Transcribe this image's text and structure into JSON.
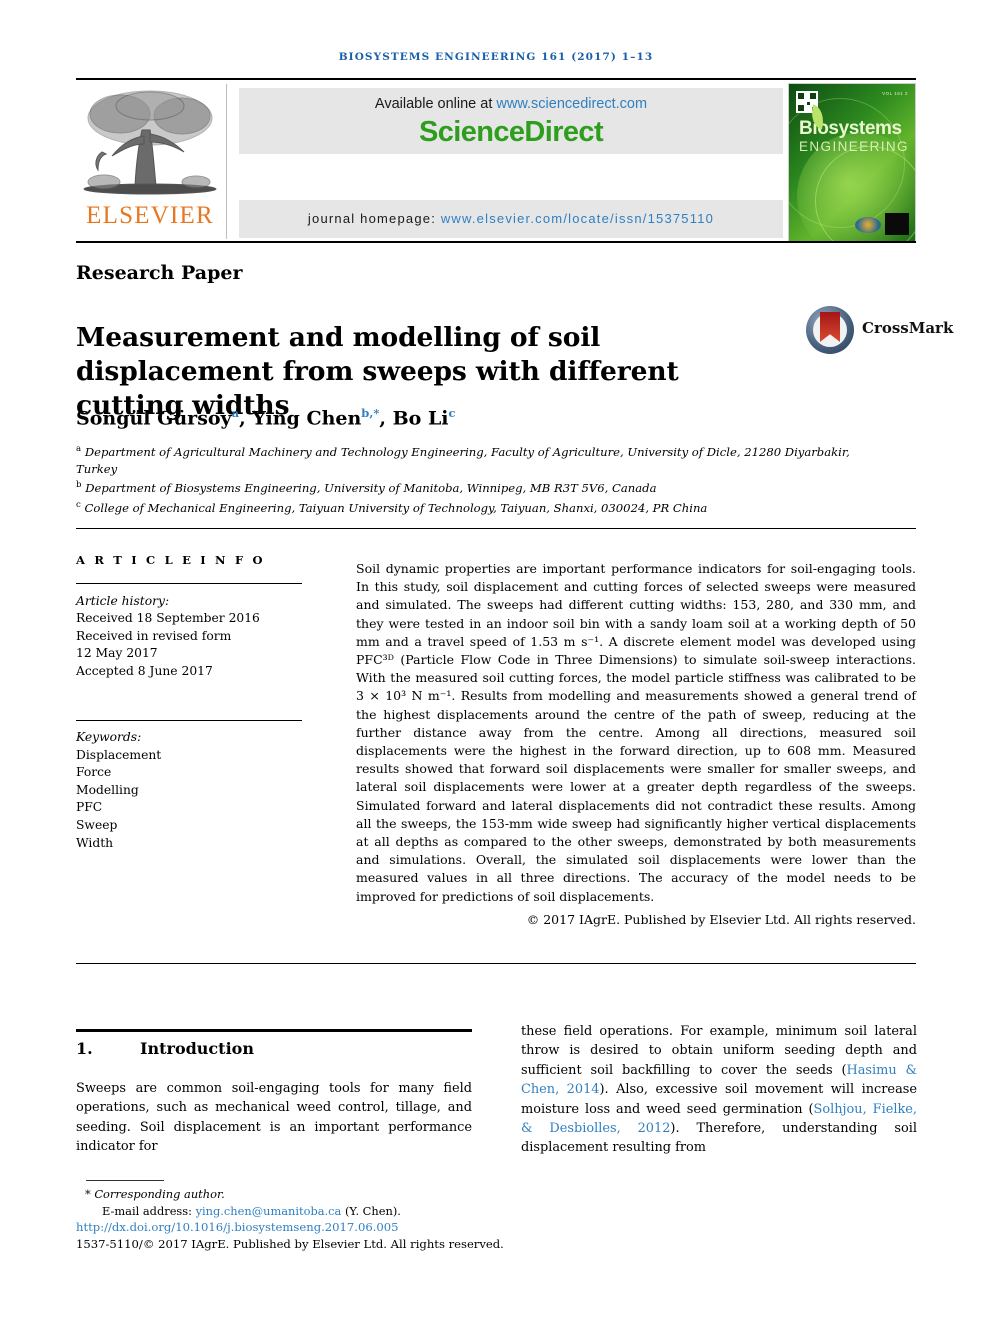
{
  "running_head": "BIOSYSTEMS ENGINEERING 161 (2017) 1–13",
  "masthead": {
    "publisher_name": "ELSEVIER",
    "available_online_label": "Available online at ",
    "sciencedirect_url": "www.sciencedirect.com",
    "sciencedirect_logo": "ScienceDirect",
    "homepage_label": "journal homepage: ",
    "homepage_url": "www.elsevier.com/locate/issn/15375110",
    "cover": {
      "title_line1": "Biosystems",
      "title_line2": "ENGINEERING",
      "volume_text": "VOL 161 2"
    }
  },
  "article": {
    "section_kind": "Research Paper",
    "title": "Measurement and modelling of soil displacement from sweeps with different cutting widths",
    "crossmark_label": "CrossMark",
    "authors": [
      {
        "name": "Songül Gürsoy",
        "marks": "a",
        "sep": ", "
      },
      {
        "name": "Ying Chen",
        "marks": "b,*",
        "sep": ", "
      },
      {
        "name": "Bo Li",
        "marks": "c",
        "sep": ""
      }
    ],
    "affiliations": [
      {
        "mark": "a",
        "text": "Department of Agricultural Machinery and Technology Engineering, Faculty of Agriculture, University of Dicle, 21280 Diyarbakir, Turkey"
      },
      {
        "mark": "b",
        "text": "Department of Biosystems Engineering, University of Manitoba, Winnipeg, MB R3T 5V6, Canada"
      },
      {
        "mark": "c",
        "text": "College of Mechanical Engineering, Taiyuan University of Technology, Taiyuan, Shanxi, 030024, PR China"
      }
    ]
  },
  "article_info": {
    "heading": "A R T I C L E   I N F O",
    "history_label": "Article history:",
    "history": [
      "Received 18 September 2016",
      "Received in revised form",
      "12 May 2017",
      "Accepted 8 June 2017"
    ],
    "keywords_label": "Keywords:",
    "keywords": [
      "Displacement",
      "Force",
      "Modelling",
      "PFC",
      "Sweep",
      "Width"
    ]
  },
  "abstract": {
    "text": "Soil dynamic properties are important performance indicators for soil-engaging tools. In this study, soil displacement and cutting forces of selected sweeps were measured and simulated. The sweeps had different cutting widths: 153, 280, and 330 mm, and they were tested in an indoor soil bin with a sandy loam soil at a working depth of 50 mm and a travel speed of 1.53 m s⁻¹. A discrete element model was developed using PFC³ᴰ (Particle Flow Code in Three Dimensions) to simulate soil-sweep interactions. With the measured soil cutting forces, the model particle stiffness was calibrated to be 3 × 10³ N m⁻¹. Results from modelling and measurements showed a general trend of the highest displacements around the centre of the path of sweep, reducing at the further distance away from the centre. Among all directions, measured soil displacements were the highest in the forward direction, up to 608 mm. Measured results showed that forward soil displacements were smaller for smaller sweeps, and lateral soil displacements were lower at a greater depth regardless of the sweeps. Simulated forward and lateral displacements did not contradict these results. Among all the sweeps, the 153-mm wide sweep had significantly higher vertical displacements at all depths as compared to the other sweeps, demonstrated by both measurements and simulations. Overall, the simulated soil displacements were lower than the measured values in all three directions. The accuracy of the model needs to be improved for predictions of soil displacements.",
    "copyright": "© 2017 IAgrE. Published by Elsevier Ltd. All rights reserved."
  },
  "body": {
    "section_number": "1.",
    "section_title": "Introduction",
    "left_column": "Sweeps are common soil-engaging tools for many field operations, such as mechanical weed control, tillage, and seeding. Soil displacement is an important performance indicator for",
    "right_column_part1": "these field operations. For example, minimum soil lateral throw is desired to obtain uniform seeding depth and sufficient soil backfilling to cover the seeds (",
    "right_column_cite1": "Hasimu & Chen, 2014",
    "right_column_part2": "). Also, excessive soil movement will increase moisture loss and weed seed germination (",
    "right_column_cite2": "Solhjou, Fielke, & Desbiolles, 2012",
    "right_column_part3": "). Therefore, understanding soil displacement resulting from"
  },
  "footnote": {
    "corresponding_author": "Corresponding author.",
    "email_label": "E-mail address: ",
    "email": "ying.chen@umanitoba.ca",
    "email_suffix": " (Y. Chen).",
    "doi": "http://dx.doi.org/10.1016/j.biosystemseng.2017.06.005",
    "issn_line": "1537-5110/© 2017 IAgrE. Published by Elsevier Ltd. All rights reserved."
  },
  "colors": {
    "link": "#2f7fc1",
    "running_head": "#1a5fa8",
    "elsevier_orange": "#e87722",
    "sciencedirect_green": "#2f9e1e"
  }
}
